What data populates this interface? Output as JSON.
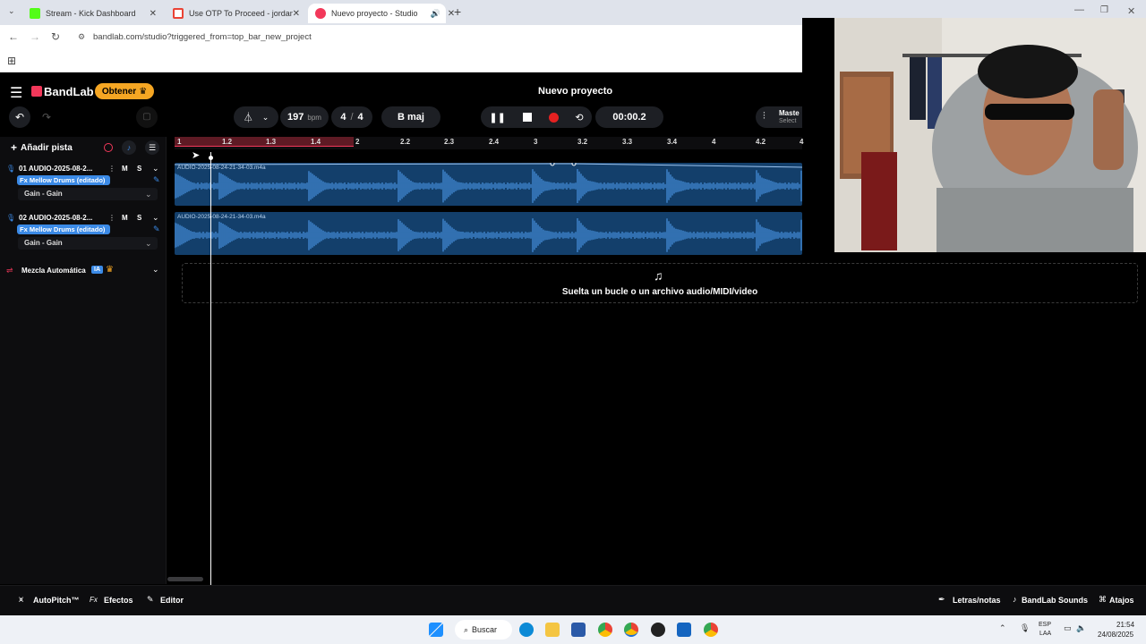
{
  "browser": {
    "tabs": [
      {
        "title": "Stream - Kick Dashboard",
        "color": "#53fc18"
      },
      {
        "title": "Use OTP To Proceed - jordano",
        "color": "#ea4335"
      },
      {
        "title": "Nuevo proyecto - Studio",
        "color": "#f2385a"
      }
    ],
    "url": "bandlab.com/studio?triggered_from=top_bar_new_project"
  },
  "app": {
    "brand": "BandLab",
    "get_button": "Obtener",
    "project_title": "Nuevo proyecto",
    "bpm_value": "197",
    "bpm_unit": "bpm",
    "time_sig_num": "4",
    "time_sig_sep": "/",
    "time_sig_den": "4",
    "key": "B maj",
    "time_display": "00:00.2",
    "master_label": "Maste",
    "master_sub": "Select",
    "add_track": "Añadir pista",
    "accent": "#f2385a"
  },
  "ruler": [
    "1",
    "1.2",
    "1.3",
    "1.4",
    "2",
    "2.2",
    "2.3",
    "2.4",
    "3",
    "3.2",
    "3.3",
    "3.4",
    "4",
    "4.2",
    "4"
  ],
  "tracks": [
    {
      "title": "01  AUDIO-2025-08-2...",
      "fx": "Fx Mellow Drums (editado)",
      "gain": "Gain - Gain",
      "clip": "AUDIO-2025-08-24-21-34-03.m4a",
      "m": "M",
      "s": "S"
    },
    {
      "title": "02  AUDIO-2025-08-2...",
      "fx": "Fx Mellow Drums (editado)",
      "gain": "Gain - Gain",
      "clip": "AUDIO-2025-08-24-21-34-03.m4a",
      "m": "M",
      "s": "S"
    }
  ],
  "automix": {
    "label": "Mezcla Automática",
    "badge": "IA"
  },
  "dropzone": {
    "text": "Suelta un bucle o un archivo audio/MIDI/video"
  },
  "bottom": {
    "autopitch": "AutoPitch™",
    "effects": "Efectos",
    "editor": "Editor",
    "lyrics": "Letras/notas",
    "sounds": "BandLab Sounds",
    "shortcuts": "Atajos"
  },
  "taskbar": {
    "search": "Buscar",
    "lang1": "ESP",
    "lang2": "LAA",
    "time": "21:54",
    "date": "24/08/2025"
  }
}
